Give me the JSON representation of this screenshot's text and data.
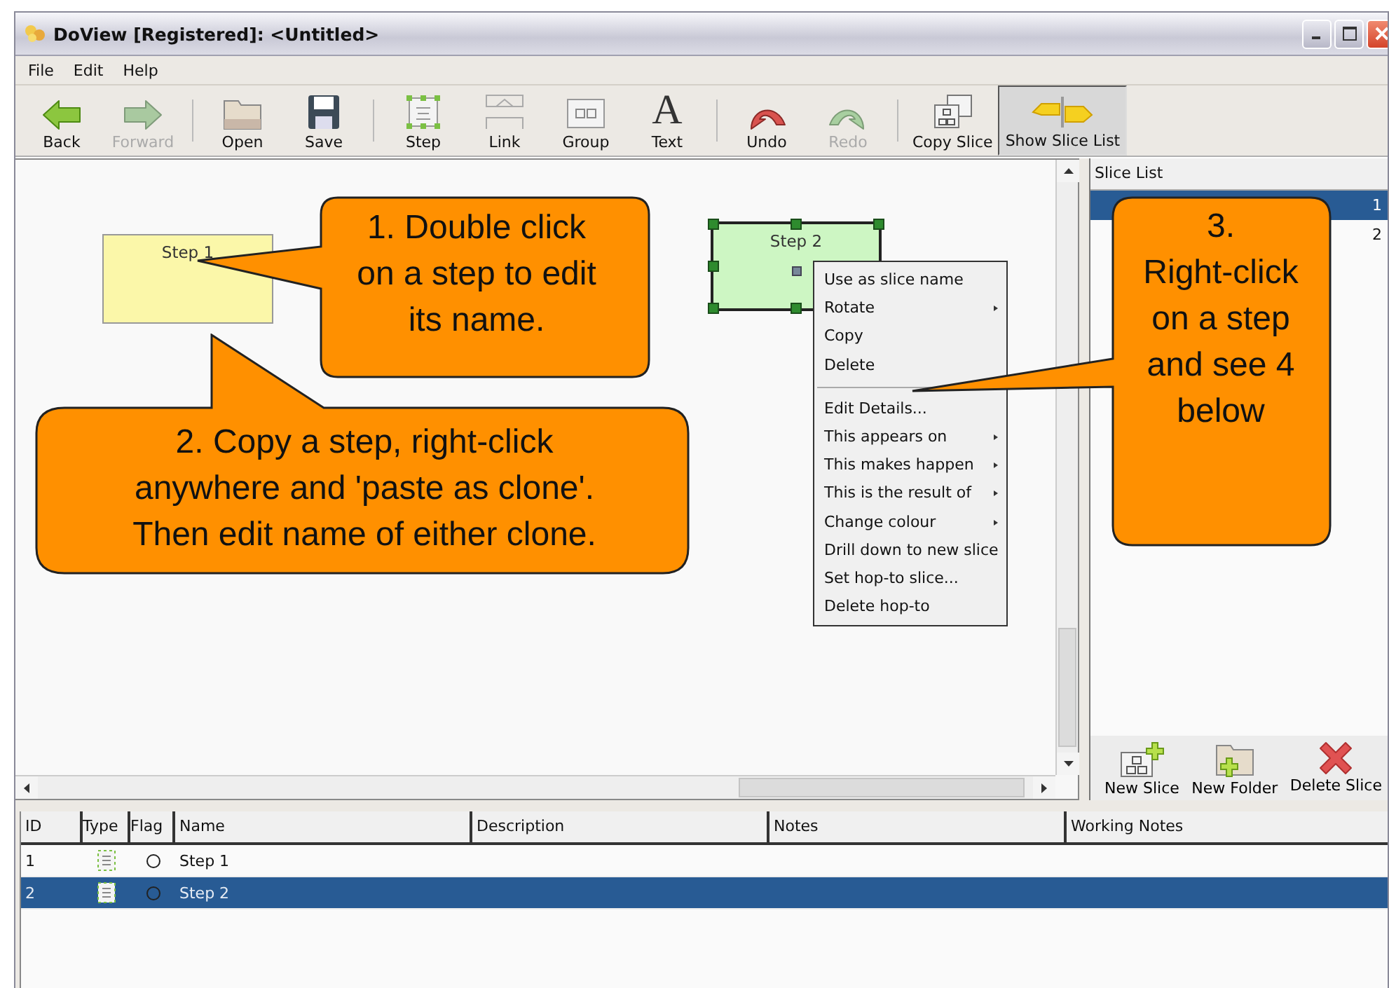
{
  "window": {
    "title": "DoView [Registered]: <Untitled>"
  },
  "menu": [
    "File",
    "Edit",
    "Help"
  ],
  "toolbar": [
    {
      "kind": "button",
      "label": "Back",
      "disabled": false,
      "selected": false
    },
    {
      "kind": "button",
      "label": "Forward",
      "disabled": true,
      "selected": false
    },
    {
      "kind": "separator"
    },
    {
      "kind": "button",
      "label": "Open",
      "disabled": false,
      "selected": false
    },
    {
      "kind": "button",
      "label": "Save",
      "disabled": false,
      "selected": false
    },
    {
      "kind": "separator"
    },
    {
      "kind": "button",
      "label": "Step",
      "disabled": false,
      "selected": false
    },
    {
      "kind": "button",
      "label": "Link",
      "disabled": false,
      "selected": false
    },
    {
      "kind": "button",
      "label": "Group",
      "disabled": false,
      "selected": false
    },
    {
      "kind": "button",
      "label": "Text",
      "glyph": "A",
      "disabled": false,
      "selected": false
    },
    {
      "kind": "separator"
    },
    {
      "kind": "button",
      "label": "Undo",
      "disabled": false,
      "selected": false
    },
    {
      "kind": "button",
      "label": "Redo",
      "disabled": true,
      "selected": false
    },
    {
      "kind": "separator"
    },
    {
      "kind": "button",
      "label": "Copy Slice",
      "disabled": false,
      "selected": false
    },
    {
      "kind": "button",
      "label": "Show Slice List",
      "disabled": false,
      "selected": true
    }
  ],
  "canvas": {
    "steps": [
      {
        "name": "Step 1",
        "color": "#fbf7a9",
        "selected": false
      },
      {
        "name": "Step 2",
        "color": "#cdf6c3",
        "selected": true
      }
    ],
    "context_menu": [
      {
        "kind": "item",
        "label": "Use as slice name",
        "submenu": false
      },
      {
        "kind": "item",
        "label": "Rotate",
        "submenu": true
      },
      {
        "kind": "item",
        "label": "Copy",
        "submenu": false
      },
      {
        "kind": "item",
        "label": "Delete",
        "submenu": false
      },
      {
        "kind": "separator"
      },
      {
        "kind": "item",
        "label": "Edit Details...",
        "submenu": false
      },
      {
        "kind": "item",
        "label": "This appears on",
        "submenu": true
      },
      {
        "kind": "item",
        "label": "This makes happen",
        "submenu": true
      },
      {
        "kind": "item",
        "label": "This is the result of",
        "submenu": true
      },
      {
        "kind": "item",
        "label": "Change colour",
        "submenu": true
      },
      {
        "kind": "item",
        "label": "Drill down to new slice",
        "submenu": false
      },
      {
        "kind": "item",
        "label": "Set hop-to slice...",
        "submenu": false
      },
      {
        "kind": "item",
        "label": "Delete hop-to",
        "submenu": false
      }
    ]
  },
  "slice_list": {
    "title": "Slice List",
    "rows": [
      {
        "number": "1",
        "selected": true
      },
      {
        "number": "2",
        "selected": false
      }
    ],
    "buttons": [
      "New Slice",
      "New Folder",
      "Delete Slice"
    ]
  },
  "table": {
    "columns": [
      "ID",
      "Type",
      "Flag",
      "Name",
      "Description",
      "Notes",
      "Working Notes"
    ],
    "rows": [
      {
        "id": "1",
        "name": "Step 1",
        "selected": false
      },
      {
        "id": "2",
        "name": "Step 2",
        "selected": true
      }
    ]
  },
  "callouts": [
    {
      "text": "1. Double click\non a step to edit\nits name."
    },
    {
      "text": "2. Copy a step, right-click\nanywhere and 'paste as clone'.\nThen edit name of either clone."
    },
    {
      "text": "3.\nRight-click\non a step\nand see 4\nbelow"
    }
  ]
}
